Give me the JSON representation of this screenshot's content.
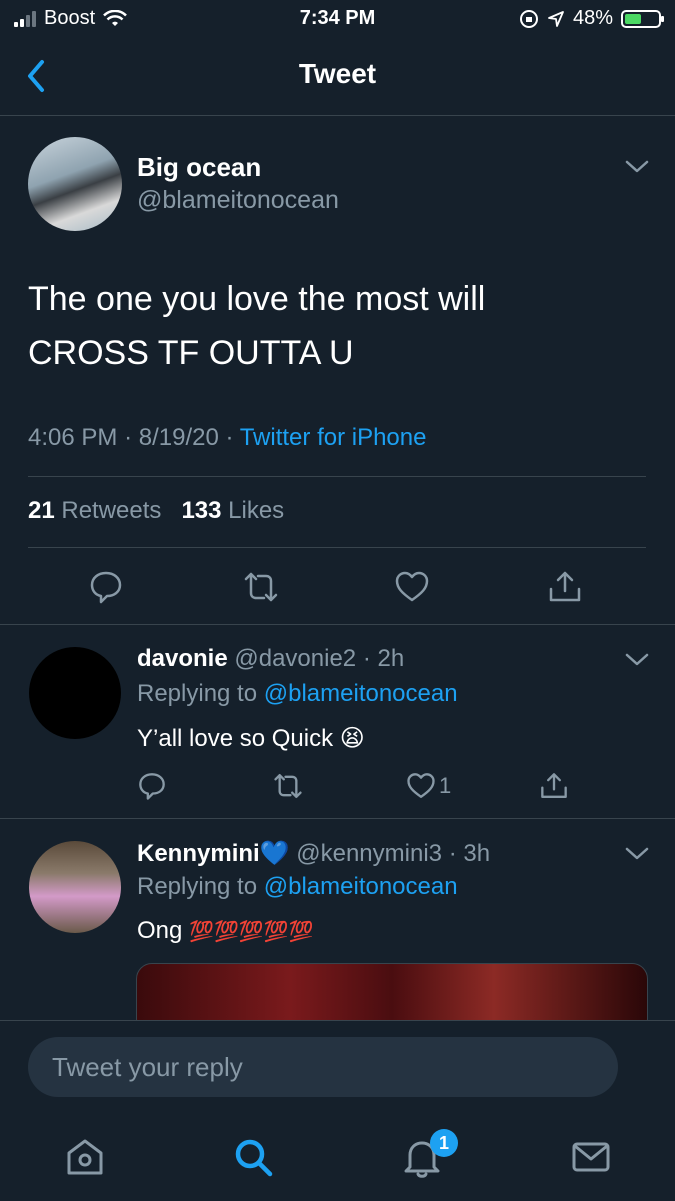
{
  "status_bar": {
    "carrier": "Boost",
    "time": "7:34 PM",
    "battery": "48%"
  },
  "header": {
    "title": "Tweet"
  },
  "tweet": {
    "author_name": "Big ocean",
    "author_handle": "@blameitonocean",
    "text_line1": "The one you love the most will",
    "text_line2": "CROSS TF OUTTA U",
    "time": "4:06 PM",
    "date": "8/19/20",
    "sep": "·",
    "source": "Twitter for iPhone",
    "retweets_count": "21",
    "retweets_label": "Retweets",
    "likes_count": "133",
    "likes_label": "Likes"
  },
  "replies": [
    {
      "name": "davonie",
      "handle": "@davonie2",
      "time": "· 2h",
      "replying_label": "Replying to",
      "replying_to": "@blameitonocean",
      "text": "Y’all love so Quick",
      "emoji": "😫",
      "like_count": "1"
    },
    {
      "name": "Kennymini",
      "badge_emoji": "💙",
      "handle": "@kennymini3",
      "time": "· 3h",
      "replying_label": "Replying to",
      "replying_to": "@blameitonocean",
      "text": "Ong",
      "emoji": "💯💯💯💯💯"
    }
  ],
  "compose": {
    "placeholder": "Tweet your reply"
  },
  "tab_bar": {
    "notifications_badge": "1"
  },
  "colors": {
    "background": "#15202b",
    "accent": "#1da1f2",
    "muted": "#8899a6",
    "divider": "#38444d"
  },
  "icons": [
    "back-icon",
    "chevron-down-icon",
    "reply-icon",
    "retweet-icon",
    "like-icon",
    "share-icon",
    "home-icon",
    "search-icon",
    "notifications-icon",
    "messages-icon"
  ]
}
